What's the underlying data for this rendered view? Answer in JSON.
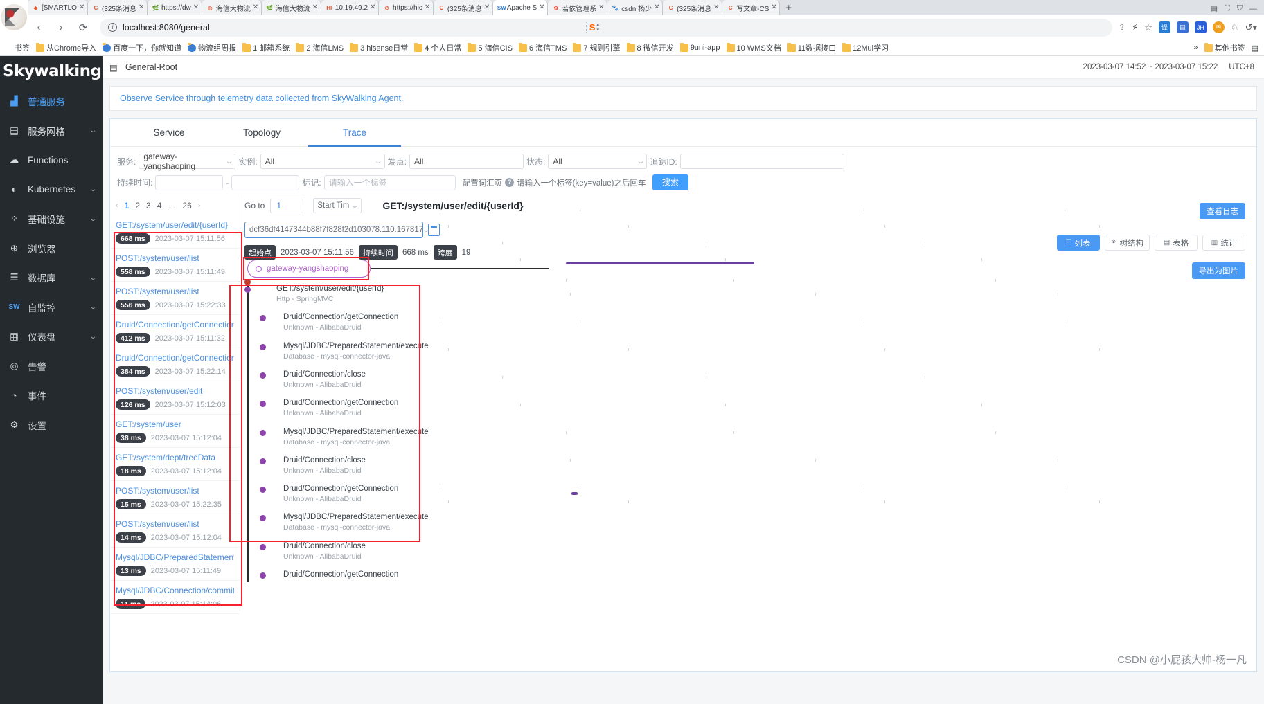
{
  "browser": {
    "tabs": [
      {
        "label": "[SMARTLO",
        "favicon": "◆",
        "color": "#2b7cd3",
        "active": false
      },
      {
        "label": "(325条消息",
        "favicon": "C",
        "color": "#fff",
        "fg": "#e8562b",
        "active": false
      },
      {
        "label": "https://dw",
        "favicon": "🌿",
        "color": "#fff",
        "active": false
      },
      {
        "label": "海信大物流",
        "favicon": "◍",
        "color": "#fff",
        "active": false
      },
      {
        "label": "海信大物流",
        "favicon": "🌿",
        "color": "#fff",
        "active": false
      },
      {
        "label": "10.19.49.2",
        "favicon": "HI",
        "color": "#fff",
        "active": false
      },
      {
        "label": "https://hic",
        "favicon": "⊘",
        "color": "#fff",
        "active": false
      },
      {
        "label": "(325条消息",
        "favicon": "C",
        "color": "#fff",
        "active": false
      },
      {
        "label": "Apache S",
        "favicon": "SW",
        "color": "#fff",
        "active": true
      },
      {
        "label": "若依管理系",
        "favicon": "✿",
        "color": "#fff",
        "active": false
      },
      {
        "label": "csdn 杨少",
        "favicon": "🐾",
        "color": "#fff",
        "active": false
      },
      {
        "label": "(325条消息",
        "favicon": "C",
        "color": "#fff",
        "active": false
      },
      {
        "label": "写文章-CS",
        "favicon": "C",
        "color": "#fff",
        "active": false
      }
    ],
    "new_tab_label": "+",
    "url": "localhost:8080/general",
    "nav": {
      "back": "‹",
      "forward": "›",
      "reload": "⟳"
    },
    "toolbar_icons": [
      "share-icon",
      "flash-icon",
      "star-icon",
      "translate-icon",
      "reader-icon",
      "jh-icon",
      "mail-icon",
      "ghost-icon",
      "history-icon"
    ],
    "minimize": "—",
    "bookmarks": [
      {
        "label": "书签",
        "type": "plain"
      },
      {
        "label": "从Chrome导入",
        "type": "folder"
      },
      {
        "label": "百度一下，你就知道",
        "type": "site"
      },
      {
        "label": "物流组周报",
        "type": "site"
      },
      {
        "label": "1 邮箱系统",
        "type": "folder"
      },
      {
        "label": "2 海信LMS",
        "type": "folder"
      },
      {
        "label": "3 hisense日常",
        "type": "folder"
      },
      {
        "label": "4 个人日常",
        "type": "folder"
      },
      {
        "label": "5 海信CIS",
        "type": "folder"
      },
      {
        "label": "6 海信TMS",
        "type": "folder"
      },
      {
        "label": "7 规则引擎",
        "type": "folder"
      },
      {
        "label": "8 微信开发",
        "type": "folder"
      },
      {
        "label": "9uni-app",
        "type": "folder"
      },
      {
        "label": "10 WMS文档",
        "type": "folder"
      },
      {
        "label": "11数据接口",
        "type": "folder"
      },
      {
        "label": "12Mui学习",
        "type": "folder"
      }
    ],
    "bookmarks_overflow": "»",
    "bookmarks_other": "其他书签"
  },
  "sidebar": {
    "logo": "Skywalking",
    "items": [
      {
        "label": "普通服务",
        "icon": "chart-icon",
        "active": true,
        "expandable": false
      },
      {
        "label": "服务网格",
        "icon": "mesh-icon",
        "active": false,
        "expandable": true
      },
      {
        "label": "Functions",
        "icon": "cloud-icon",
        "active": false,
        "expandable": false
      },
      {
        "label": "Kubernetes",
        "icon": "k8s-icon",
        "active": false,
        "expandable": true
      },
      {
        "label": "基础设施",
        "icon": "nodes-icon",
        "active": false,
        "expandable": true
      },
      {
        "label": "浏览器",
        "icon": "globe-icon",
        "active": false,
        "expandable": false
      },
      {
        "label": "数据库",
        "icon": "database-icon",
        "active": false,
        "expandable": true
      },
      {
        "label": "自监控",
        "icon": "sw-icon",
        "active": false,
        "expandable": true
      },
      {
        "label": "仪表盘",
        "icon": "dashboard-icon",
        "active": false,
        "expandable": true
      },
      {
        "label": "告警",
        "icon": "alarm-icon",
        "active": false,
        "expandable": false
      },
      {
        "label": "事件",
        "icon": "event-icon",
        "active": false,
        "expandable": false
      },
      {
        "label": "设置",
        "icon": "gear-icon",
        "active": false,
        "expandable": false
      }
    ]
  },
  "topbar": {
    "title": "General-Root",
    "time_range": "2023-03-07 14:52 ~ 2023-03-07 15:22",
    "timezone": "UTC+8"
  },
  "banner": "Observe Service through telemetry data collected from SkyWalking Agent.",
  "tabs": [
    {
      "label": "Service",
      "active": false
    },
    {
      "label": "Topology",
      "active": false
    },
    {
      "label": "Trace",
      "active": true
    }
  ],
  "filters": {
    "service_label": "服务:",
    "service_value": "gateway-yangshaoping",
    "instance_label": "实例:",
    "instance_value": "All",
    "endpoint_label": "端点:",
    "endpoint_value": "All",
    "status_label": "状态:",
    "status_value": "All",
    "traceid_label": "追踪ID:",
    "traceid_value": "",
    "duration_label": "持续时间:",
    "duration_min": "",
    "duration_dash": "-",
    "duration_max": "",
    "tags_label": "标记:",
    "tags_placeholder": "请输入一个标签",
    "vocab_link": "配置词汇页",
    "tags_hint": "请输入一个标签(key=value)之后回车",
    "search_button": "搜索"
  },
  "pager": {
    "prev": "‹",
    "pages": [
      "1",
      "2",
      "3",
      "4",
      "…",
      "26"
    ],
    "current": "1",
    "next": "›",
    "goto_label": "Go to",
    "goto_value": "1",
    "sort_label": "Start Tim"
  },
  "trace_list": [
    {
      "name": "GET:/system/user/edit/{userId}",
      "duration": "668 ms",
      "time": "2023-03-07 15:11:56"
    },
    {
      "name": "POST:/system/user/list",
      "duration": "558 ms",
      "time": "2023-03-07 15:11:49"
    },
    {
      "name": "POST:/system/user/list",
      "duration": "556 ms",
      "time": "2023-03-07 15:22:33"
    },
    {
      "name": "Druid/Connection/getConnection",
      "duration": "412 ms",
      "time": "2023-03-07 15:11:32"
    },
    {
      "name": "Druid/Connection/getConnection",
      "duration": "384 ms",
      "time": "2023-03-07 15:22:14"
    },
    {
      "name": "POST:/system/user/edit",
      "duration": "126 ms",
      "time": "2023-03-07 15:12:03"
    },
    {
      "name": "GET:/system/user",
      "duration": "38 ms",
      "time": "2023-03-07 15:12:04"
    },
    {
      "name": "GET:/system/dept/treeData",
      "duration": "18 ms",
      "time": "2023-03-07 15:12:04"
    },
    {
      "name": "POST:/system/user/list",
      "duration": "15 ms",
      "time": "2023-03-07 15:22:35"
    },
    {
      "name": "POST:/system/user/list",
      "duration": "14 ms",
      "time": "2023-03-07 15:12:04"
    },
    {
      "name": "Mysql/JDBC/PreparedStatement/execute",
      "duration": "13 ms",
      "time": "2023-03-07 15:11:49"
    },
    {
      "name": "Mysql/JDBC/Connection/commit",
      "duration": "11 ms",
      "time": "2023-03-07 15:14:06"
    }
  ],
  "detail": {
    "title": "GET:/system/user/edit/{userId}",
    "trace_id": "dcf36df4147344b88f7f828f2d103078.110.167817",
    "start_label": "起始点",
    "start_value": "2023-03-07 15:11:56",
    "duration_label": "持续时间",
    "duration_value": "668 ms",
    "span_label": "跨度",
    "span_value": "19",
    "view_log_button": "查看日志",
    "export_button": "导出为图片",
    "view_modes": [
      {
        "label": "列表",
        "icon": "list-icon",
        "active": true
      },
      {
        "label": "树结构",
        "icon": "tree-icon",
        "active": false
      },
      {
        "label": "表格",
        "icon": "table-icon",
        "active": false
      },
      {
        "label": "统计",
        "icon": "stats-icon",
        "active": false
      }
    ],
    "service_node": "gateway-yangshaoping",
    "spans": [
      {
        "name": "GET:/system/user/edit/{userId}",
        "sub": "Http - SpringMVC",
        "indent": 1
      },
      {
        "name": "Druid/Connection/getConnection",
        "sub": "Unknown - AlibabaDruid",
        "indent": 2
      },
      {
        "name": "Mysql/JDBC/PreparedStatement/execute",
        "sub": "Database - mysql-connector-java",
        "indent": 2
      },
      {
        "name": "Druid/Connection/close",
        "sub": "Unknown - AlibabaDruid",
        "indent": 2
      },
      {
        "name": "Druid/Connection/getConnection",
        "sub": "Unknown - AlibabaDruid",
        "indent": 2
      },
      {
        "name": "Mysql/JDBC/PreparedStatement/execute",
        "sub": "Database - mysql-connector-java",
        "indent": 2
      },
      {
        "name": "Druid/Connection/close",
        "sub": "Unknown - AlibabaDruid",
        "indent": 2
      },
      {
        "name": "Druid/Connection/getConnection",
        "sub": "Unknown - AlibabaDruid",
        "indent": 2
      },
      {
        "name": "Mysql/JDBC/PreparedStatement/execute",
        "sub": "Database - mysql-connector-java",
        "indent": 2
      },
      {
        "name": "Druid/Connection/close",
        "sub": "Unknown - AlibabaDruid",
        "indent": 2
      },
      {
        "name": "Druid/Connection/getConnection",
        "sub": "",
        "indent": 2
      }
    ]
  },
  "watermark": "CSDN @小屁孩大帅-杨一凡",
  "colors": {
    "accent": "#4a90e2",
    "sidebar_bg": "#252a2f",
    "highlight_red": "#f5222d",
    "purple": "#b05ecf",
    "bar_purple": "#6b3fa0"
  }
}
